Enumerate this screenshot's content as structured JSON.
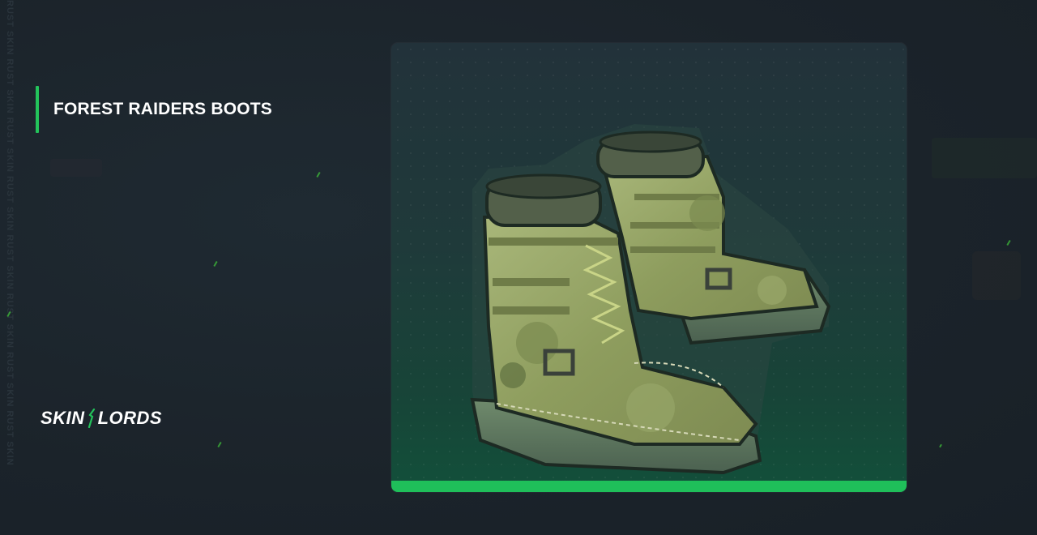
{
  "item": {
    "title": "FOREST RAIDERS BOOTS"
  },
  "brand": {
    "logo_left": "SKIN",
    "logo_right": "LORDS"
  },
  "watermark": {
    "side_text": "RUST SKIN RUST SKIN RUST SKIN RUST SKIN RUST SKIN RUST SKIN RUST SKIN RUST SKIN"
  },
  "colors": {
    "accent": "#23c35b",
    "background": "#1d262e",
    "card_bottom_bar": "#1fbf5a"
  },
  "icons": {
    "product_image": "camo-boots-icon"
  }
}
